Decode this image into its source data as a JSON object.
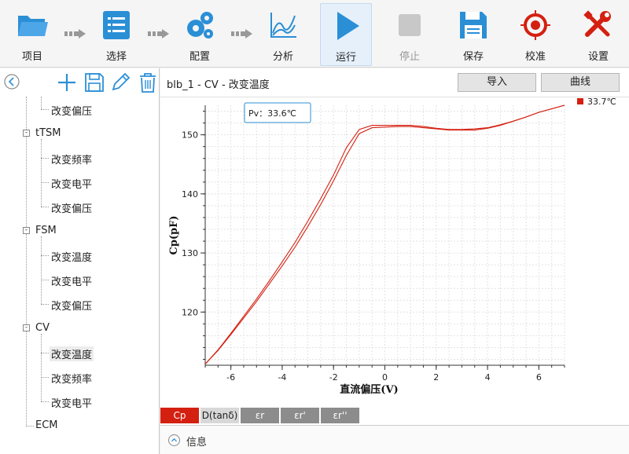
{
  "toolbar": {
    "items": [
      {
        "label": "项目",
        "icon": "folder-icon"
      },
      {
        "label": "选择",
        "icon": "list-icon"
      },
      {
        "label": "配置",
        "icon": "gears-icon"
      },
      {
        "label": "分析",
        "icon": "chart-icon"
      },
      {
        "label": "运行",
        "icon": "play-icon"
      },
      {
        "label": "停止",
        "icon": "stop-icon"
      },
      {
        "label": "保存",
        "icon": "save-icon"
      },
      {
        "label": "校准",
        "icon": "target-icon"
      },
      {
        "label": "设置",
        "icon": "tools-icon"
      }
    ]
  },
  "tree": {
    "nodes": [
      {
        "label": "改变偏压"
      },
      {
        "label": "tTSM"
      },
      {
        "label": "改变频率"
      },
      {
        "label": "改变电平"
      },
      {
        "label": "改变偏压"
      },
      {
        "label": "FSM"
      },
      {
        "label": "改变温度"
      },
      {
        "label": "改变电平"
      },
      {
        "label": "改变偏压"
      },
      {
        "label": "CV"
      },
      {
        "label": "改变温度"
      },
      {
        "label": "改变频率"
      },
      {
        "label": "改变电平"
      },
      {
        "label": "ECM"
      }
    ]
  },
  "panel": {
    "title": "blb_1 - CV - 改变温度",
    "import_label": "导入",
    "curve_label": "曲线"
  },
  "tabs": [
    {
      "label": "Cp"
    },
    {
      "label": "D(tanδ)"
    },
    {
      "label": "εr"
    },
    {
      "label": "εr'"
    },
    {
      "label": "εr''"
    }
  ],
  "info": {
    "label": "信息"
  },
  "colors": {
    "accent": "#2b8fd6",
    "series": "#d42010",
    "tab_active": "#d42010"
  },
  "chart_data": {
    "type": "line",
    "xlabel": "直流偏压(V)",
    "ylabel": "Cp(pF)",
    "xlim": [
      -7,
      7
    ],
    "ylim": [
      111,
      155
    ],
    "xticks": [
      -6,
      -4,
      -2,
      0,
      2,
      4,
      6
    ],
    "yticks": [
      120,
      130,
      140,
      150
    ],
    "grid": true,
    "legend_position": "top-right",
    "cursor_label": "Pv：33.6℃",
    "series": [
      {
        "name": "33.7℃",
        "x": [
          -7,
          -6.5,
          -6,
          -5.5,
          -5,
          -4.5,
          -4,
          -3.5,
          -3,
          -2.5,
          -2,
          -1.5,
          -1,
          -0.5,
          0,
          0.5,
          1,
          1.5,
          2,
          2.5,
          3,
          3.5,
          4,
          4.5,
          5,
          5.5,
          6,
          6.5,
          7
        ],
        "y": [
          111.2,
          113.5,
          116.2,
          119.0,
          121.8,
          124.8,
          127.8,
          131.0,
          134.5,
          138.2,
          142.2,
          146.5,
          150.2,
          151.2,
          151.3,
          151.4,
          151.4,
          151.2,
          151.0,
          150.8,
          150.8,
          150.8,
          151.1,
          151.6,
          152.3,
          153.0,
          153.8,
          154.4,
          155.0
        ]
      },
      {
        "name": "",
        "x": [
          -7,
          -6.5,
          -6,
          -5.5,
          -5,
          -4.5,
          -4,
          -3.5,
          -3,
          -2.5,
          -2,
          -1.5,
          -1,
          -0.5,
          0,
          0.5,
          1,
          1.5,
          2,
          2.5,
          3,
          3.5,
          4,
          4.5,
          5,
          5.5,
          6,
          6.5,
          7
        ],
        "y": [
          111.2,
          113.6,
          116.4,
          119.3,
          122.2,
          125.3,
          128.5,
          131.8,
          135.4,
          139.2,
          143.2,
          147.8,
          150.9,
          151.6,
          151.6,
          151.6,
          151.6,
          151.4,
          151.1,
          150.9,
          150.9,
          151.0,
          151.2,
          151.7,
          152.3,
          153.0,
          153.8,
          154.4,
          155.0
        ]
      }
    ]
  }
}
